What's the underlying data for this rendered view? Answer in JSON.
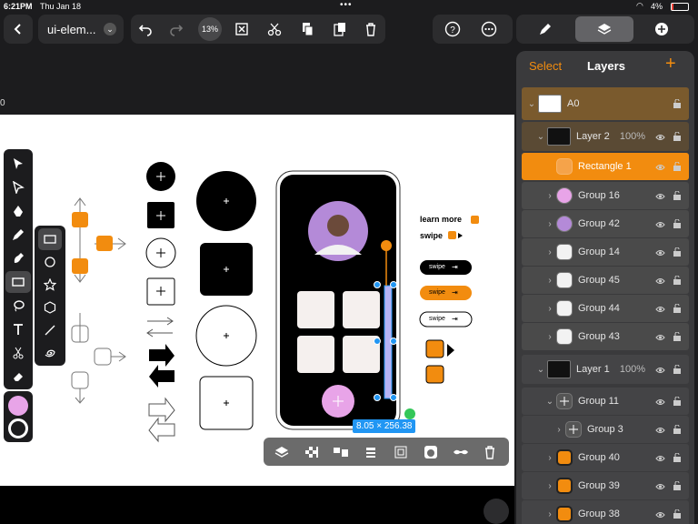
{
  "status": {
    "time": "6:21PM",
    "date": "Thu Jan 18",
    "battery": "4%"
  },
  "document": {
    "title": "ui-elem...",
    "zoom": "13%"
  },
  "panel": {
    "select_label": "Select",
    "title": "Layers",
    "add_label": "+"
  },
  "layers": [
    {
      "name": "A0",
      "level": 0,
      "kind": "artboard"
    },
    {
      "name": "Layer 2",
      "level": 1,
      "opacity": "100%",
      "kind": "layer"
    },
    {
      "name": "Rectangle 1",
      "level": 2,
      "kind": "selected"
    },
    {
      "name": "Group 16",
      "level": 2,
      "kind": "pink"
    },
    {
      "name": "Group 42",
      "level": 2,
      "kind": "photo"
    },
    {
      "name": "Group 14",
      "level": 2,
      "kind": "white"
    },
    {
      "name": "Group 45",
      "level": 2,
      "kind": "white"
    },
    {
      "name": "Group 44",
      "level": 2,
      "kind": "white"
    },
    {
      "name": "Group 43",
      "level": 2,
      "kind": "white"
    },
    {
      "name": "Layer 1",
      "level": 1,
      "opacity": "100%",
      "kind": "layer"
    },
    {
      "name": "Group 11",
      "level": 2,
      "kind": "plus"
    },
    {
      "name": "Group 3",
      "level": 3,
      "kind": "plus"
    },
    {
      "name": "Group 40",
      "level": 2,
      "kind": "orange"
    },
    {
      "name": "Group 39",
      "level": 2,
      "kind": "orange"
    },
    {
      "name": "Group 38",
      "level": 2,
      "kind": "orange"
    }
  ],
  "canvas": {
    "learn_more": "learn more",
    "swipe": "swipe",
    "pill_label": "swipe",
    "size_tag": "8.05 × 256.38",
    "edge_label": "0"
  },
  "colors": {
    "accent": "#f28c0f",
    "selection": "#2196f3",
    "pink": "#e8a4e8"
  }
}
